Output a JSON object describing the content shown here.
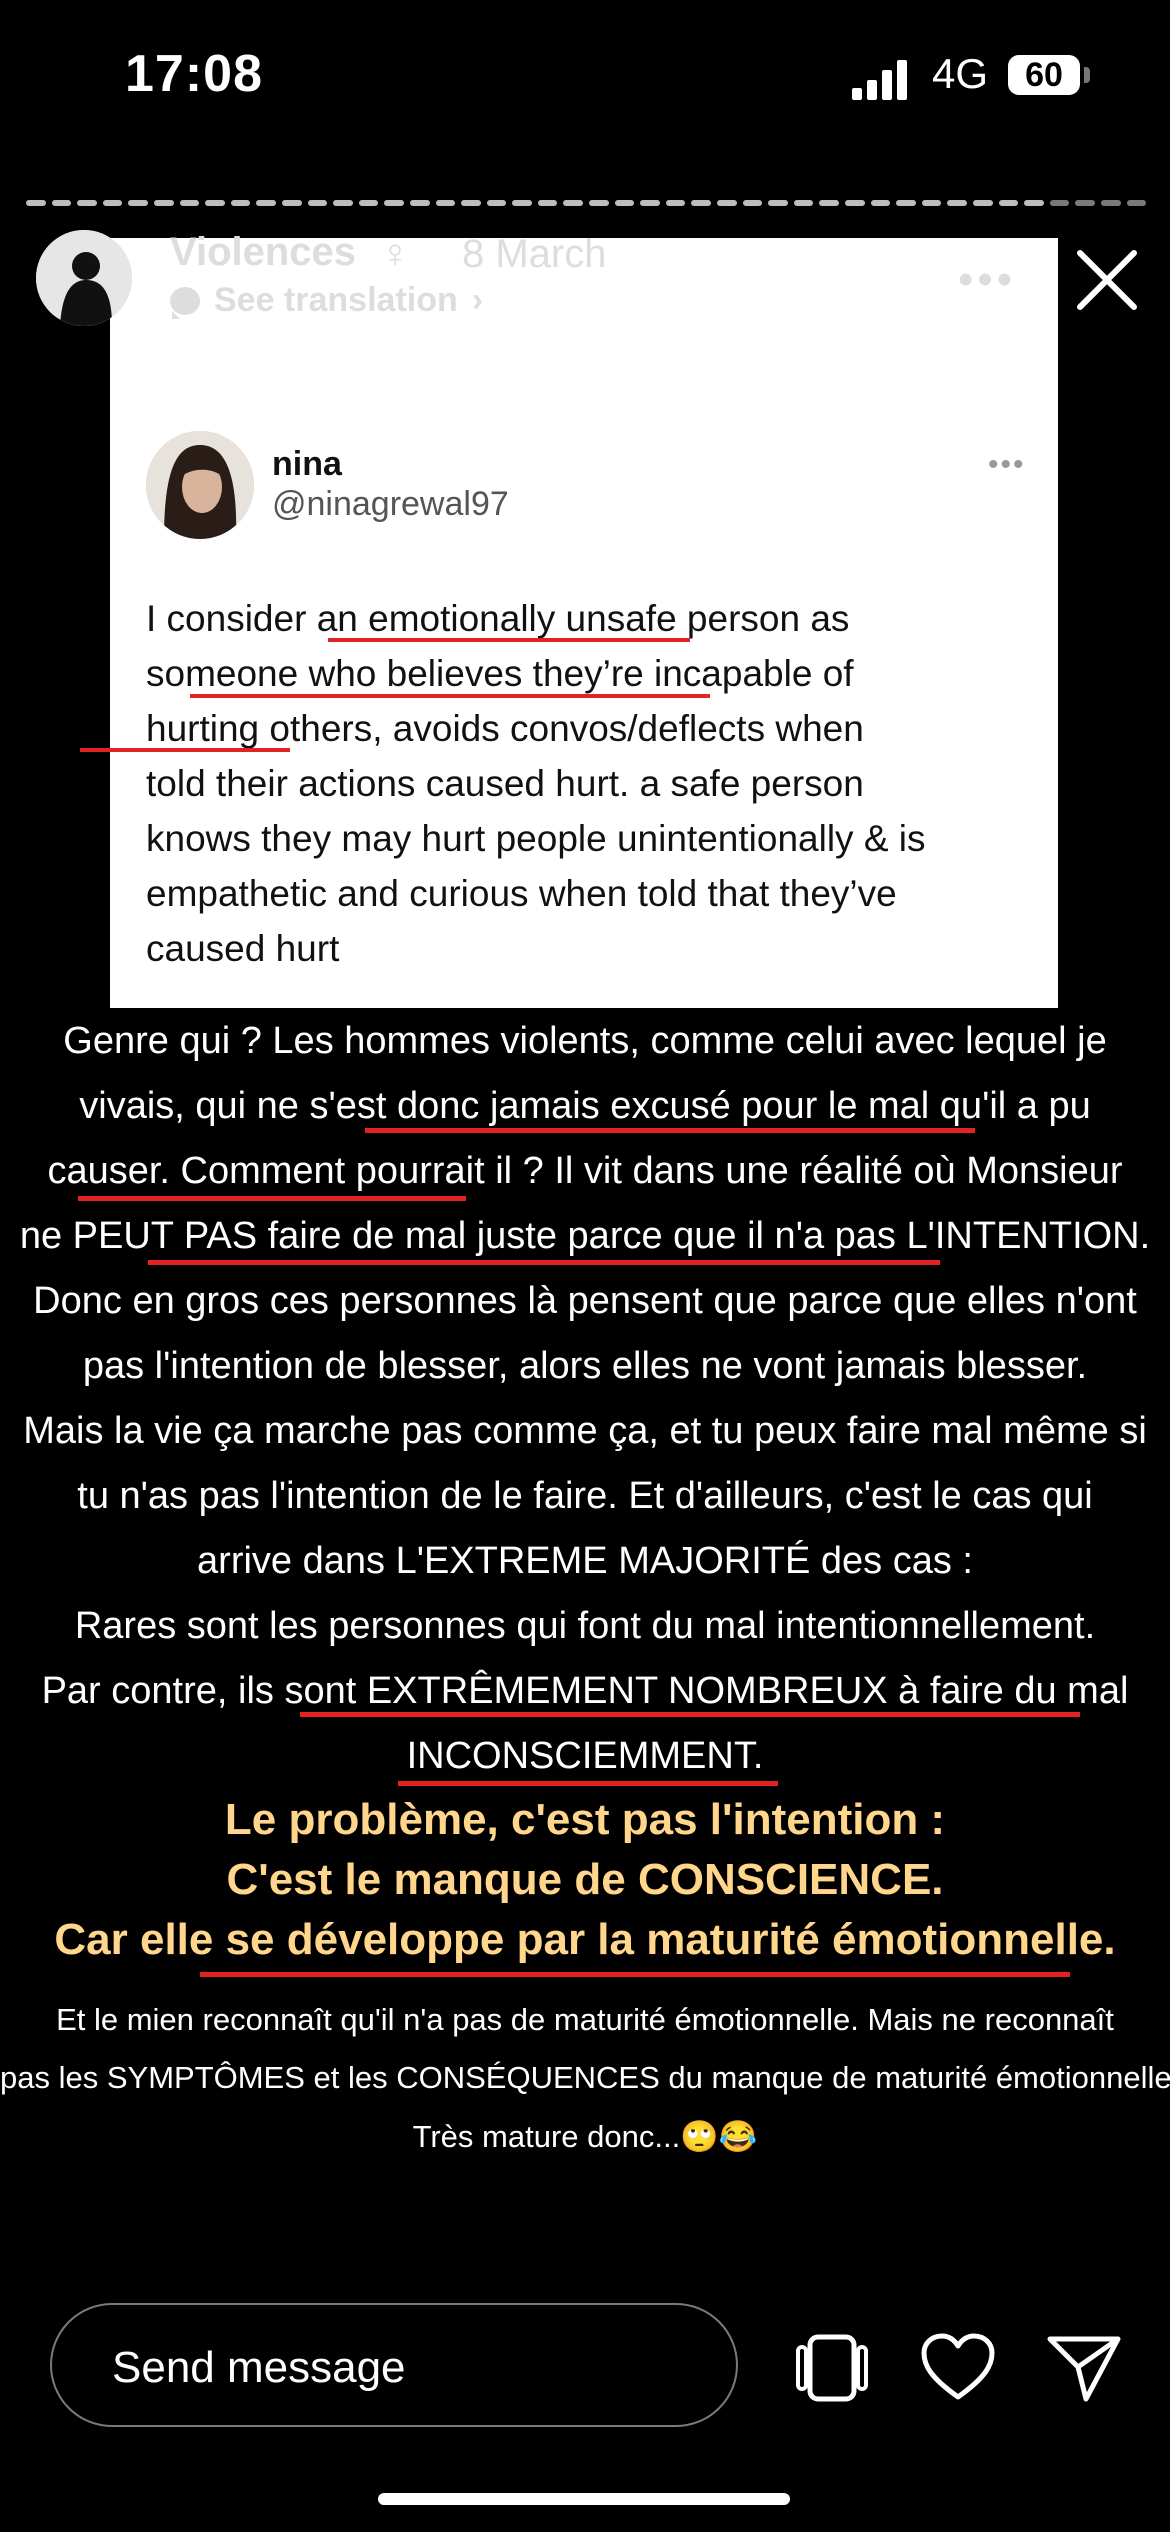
{
  "status": {
    "time": "17:08",
    "network": "4G",
    "battery": "60"
  },
  "story": {
    "username": "Violences",
    "symbol": "♀",
    "date": "8 March",
    "translate_label": "See translation",
    "more_label": "•••"
  },
  "tweet": {
    "name": "nina",
    "handle": "@ninagrewal97",
    "more": "•••",
    "lines": [
      "I consider an emotionally unsafe person as",
      "someone who believes they’re incapable of",
      "hurting others, avoids convos/deflects when",
      "told their actions caused hurt. a safe person",
      "knows they may hurt people unintentionally & is",
      "empathetic and curious when told that they’ve",
      "caused hurt"
    ]
  },
  "caption": {
    "lines": [
      "Genre qui ? Les hommes violents, comme celui avec lequel je",
      "vivais, qui ne s'est donc jamais excusé pour le mal qu'il a pu",
      "causer. Comment pourrait il ? Il vit dans une réalité où Monsieur",
      "ne PEUT PAS faire de mal juste parce que il n'a pas L'INTENTION.",
      "Donc en gros ces personnes là pensent que parce que elles n'ont",
      "pas l'intention de blesser, alors elles ne vont jamais blesser.",
      "Mais la vie ça marche pas comme ça, et tu peux faire mal même si",
      "tu n'as pas l'intention de le faire. Et d'ailleurs, c'est le cas qui",
      "arrive dans L'EXTREME MAJORITÉ des cas :",
      "Rares sont les personnes qui font du mal intentionnellement.",
      "Par contre, ils sont EXTRÊMEMENT NOMBREUX à faire du mal",
      "INCONSCIEMMENT."
    ],
    "highlight": [
      "Le problème, c'est pas l'intention :",
      "C'est le manque de CONSCIENCE.",
      "Car elle se développe par la maturité émotionnelle."
    ],
    "footer": [
      "Et le mien reconnaît qu'il n'a pas de maturité émotionnelle. Mais ne reconnaît",
      "pas les SYMPTÔMES et les CONSÉQUENCES du manque de maturité émotionnelle.",
      "Très mature donc...🙄😂"
    ]
  },
  "composer": {
    "placeholder": "Send message"
  },
  "icons": [
    "close-icon",
    "stickers-icon",
    "heart-icon",
    "send-icon"
  ]
}
